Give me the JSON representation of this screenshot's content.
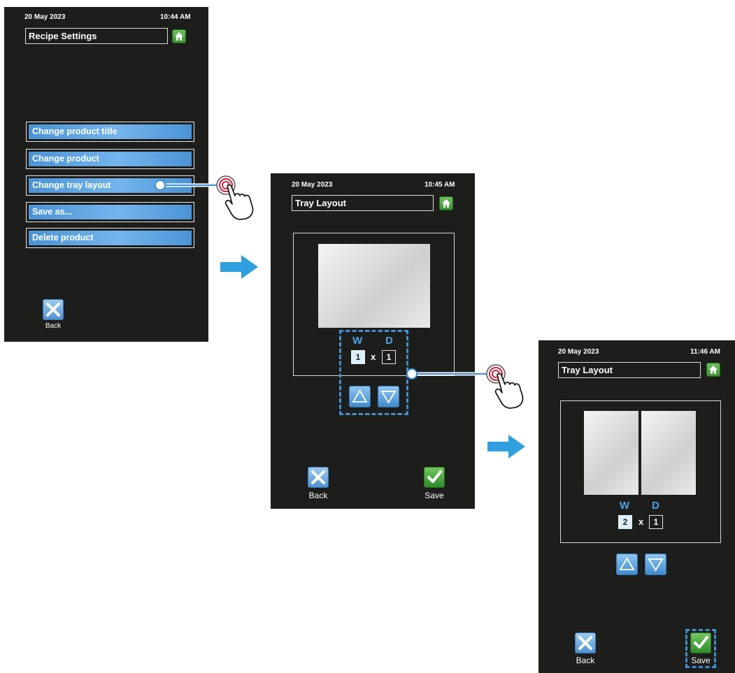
{
  "screen1": {
    "date": "20 May 2023",
    "time": "10:44 AM",
    "title": "Recipe Settings",
    "menu": [
      {
        "label": "Change product title"
      },
      {
        "label": "Change product"
      },
      {
        "label": "Change tray layout"
      },
      {
        "label": "Save as..."
      },
      {
        "label": "Delete product"
      }
    ],
    "back_label": "Back"
  },
  "screen2": {
    "date": "20 May 2023",
    "time": "10:45 AM",
    "title": "Tray Layout",
    "w_label": "W",
    "d_label": "D",
    "w_value": "1",
    "d_value": "1",
    "x_sep": "x",
    "back_label": "Back",
    "save_label": "Save"
  },
  "screen3": {
    "date": "20 May 2023",
    "time": "11:46 AM",
    "title": "Tray Layout",
    "w_label": "W",
    "d_label": "D",
    "w_value": "2",
    "d_value": "1",
    "x_sep": "x",
    "back_label": "Back",
    "save_label": "Save"
  },
  "icons": {
    "home": "home-icon",
    "back": "close-x-icon",
    "save": "checkmark-icon",
    "up": "triangle-up-icon",
    "down": "triangle-down-icon",
    "touch": "hand-tap-icon",
    "flow": "arrow-right-icon"
  },
  "colors": {
    "screen_bg": "#1d1d1b",
    "accent_blue": "#3c8fd5",
    "button_blue": "#5aa3e3",
    "green": "#3b9232"
  }
}
